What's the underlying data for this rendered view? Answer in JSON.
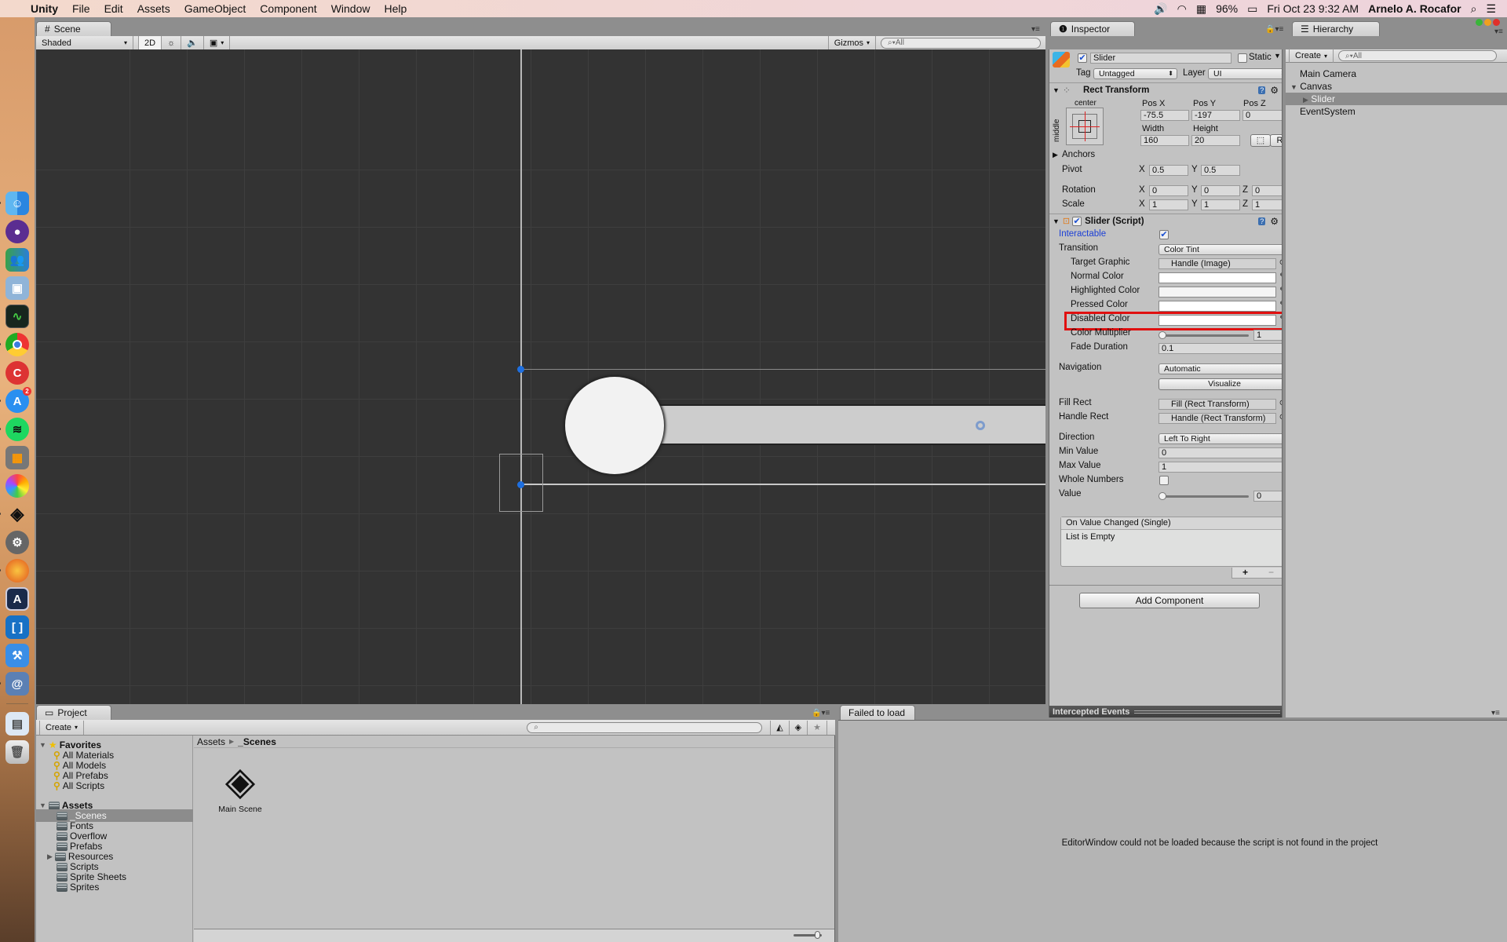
{
  "menubar": {
    "app": "Unity",
    "items": [
      "File",
      "Edit",
      "Assets",
      "GameObject",
      "Component",
      "Window",
      "Help"
    ],
    "battery": "96%",
    "datetime": "Fri Oct 23  9:32 AM",
    "user": "Arnelo A. Rocafor"
  },
  "dock": {
    "apps": [
      "Finder",
      "GitHub",
      "Messenger",
      "Preview",
      "Activity Monitor",
      "Google Chrome",
      "CCleaner",
      "App Store",
      "Spotify",
      "Calculator",
      "Photos",
      "Unity",
      "System Preferences",
      "Firefox",
      "Xcode Instruments",
      "Brackets",
      "Xcode",
      "MonoDevelop-Unity"
    ],
    "app_store_badge": "2",
    "others": [
      "Downloads",
      "Trash"
    ]
  },
  "scene": {
    "tab": "Scene",
    "shading": "Shaded",
    "mode_2d": "2D",
    "gizmos": "Gizmos",
    "search_placeholder": "All"
  },
  "inspector": {
    "tab": "Inspector",
    "object_name": "Slider",
    "active": true,
    "static_label": "Static",
    "tag_label": "Tag",
    "tag_value": "Untagged",
    "layer_label": "Layer",
    "layer_value": "UI",
    "rect_transform": {
      "title": "Rect Transform",
      "anchor_h": "center",
      "anchor_v": "middle",
      "pos_x_label": "Pos X",
      "pos_x": "-75.5",
      "pos_y_label": "Pos Y",
      "pos_y": "-197",
      "pos_z_label": "Pos Z",
      "pos_z": "0",
      "width_label": "Width",
      "width": "160",
      "height_label": "Height",
      "height": "20",
      "raw_btn": "R",
      "anchors_label": "Anchors",
      "pivot_label": "Pivot",
      "pivot_x": "0.5",
      "pivot_y": "0.5",
      "rotation_label": "Rotation",
      "rot_x": "0",
      "rot_y": "0",
      "rot_z": "0",
      "scale_label": "Scale",
      "scale_x": "1",
      "scale_y": "1",
      "scale_z": "1",
      "x": "X",
      "y": "Y",
      "z": "Z"
    },
    "slider_script": {
      "title": "Slider (Script)",
      "interactable_label": "Interactable",
      "interactable": true,
      "transition_label": "Transition",
      "transition": "Color Tint",
      "target_graphic_label": "Target Graphic",
      "target_graphic": "Handle (Image)",
      "normal_color_label": "Normal Color",
      "highlighted_color_label": "Highlighted Color",
      "pressed_color_label": "Pressed Color",
      "disabled_color_label": "Disabled Color",
      "color_multiplier_label": "Color Multiplier",
      "color_multiplier": "1",
      "fade_duration_label": "Fade Duration",
      "fade_duration": "0.1",
      "navigation_label": "Navigation",
      "navigation": "Automatic",
      "visualize": "Visualize",
      "fill_rect_label": "Fill Rect",
      "fill_rect": "Fill (Rect Transform)",
      "handle_rect_label": "Handle Rect",
      "handle_rect": "Handle (Rect Transform)",
      "direction_label": "Direction",
      "direction": "Left To Right",
      "min_value_label": "Min Value",
      "min_value": "0",
      "max_value_label": "Max Value",
      "max_value": "1",
      "whole_numbers_label": "Whole Numbers",
      "whole_numbers": false,
      "value_label": "Value",
      "value": "0",
      "event_title": "On Value Changed (Single)",
      "event_empty": "List is Empty",
      "plus": "+",
      "minus": "−"
    },
    "add_component": "Add Component",
    "intercepted_events": "Intercepted Events",
    "highlight_color": "#e01010"
  },
  "hierarchy": {
    "tab": "Hierarchy",
    "create": "Create",
    "search_placeholder": "All",
    "items": [
      {
        "label": "Main Camera"
      },
      {
        "label": "Canvas"
      },
      {
        "label": "Slider"
      },
      {
        "label": "EventSystem"
      }
    ]
  },
  "project": {
    "tab": "Project",
    "create": "Create",
    "favorites_label": "Favorites",
    "favorites": [
      "All Materials",
      "All Models",
      "All Prefabs",
      "All Scripts"
    ],
    "assets_label": "Assets",
    "folders": [
      "_Scenes",
      "Fonts",
      "Overflow",
      "Prefabs",
      "Resources",
      "Scripts",
      "Sprite Sheets",
      "Sprites"
    ],
    "breadcrumb": [
      "Assets",
      "_Scenes"
    ],
    "files": [
      {
        "name": "Main Scene"
      }
    ]
  },
  "failed_panel": {
    "tab": "Failed to load",
    "message": "EditorWindow could not be loaded because the script is not found in the project"
  }
}
